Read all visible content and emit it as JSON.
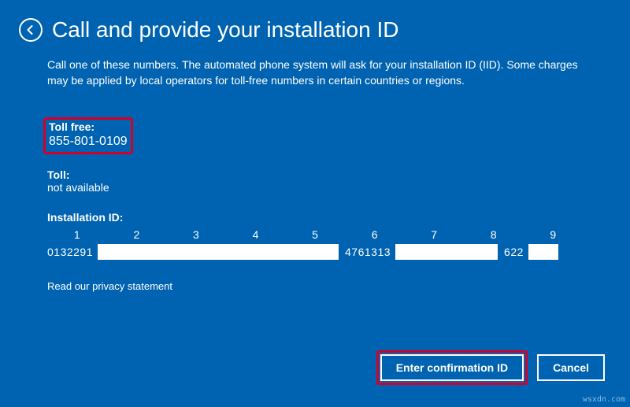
{
  "header": {
    "title": "Call and provide your installation ID"
  },
  "intro": "Call one of these numbers. The automated phone system will ask for your installation ID (IID). Some charges may be applied by local operators for toll-free numbers in certain countries or regions.",
  "tollfree": {
    "label": "Toll free:",
    "value": "855-801-0109"
  },
  "toll": {
    "label": "Toll:",
    "value": "not available"
  },
  "iid": {
    "label": "Installation ID:",
    "cols": {
      "c1": "1",
      "c2": "2",
      "c3": "3",
      "c4": "4",
      "c5": "5",
      "c6": "6",
      "c7": "7",
      "c8": "8",
      "c9": "9"
    },
    "seg1": "0132291",
    "seg6": "4761313",
    "seg9": "622"
  },
  "privacy": "Read our privacy statement",
  "buttons": {
    "confirm": "Enter confirmation ID",
    "cancel": "Cancel"
  },
  "watermark": "wsxdn.com"
}
